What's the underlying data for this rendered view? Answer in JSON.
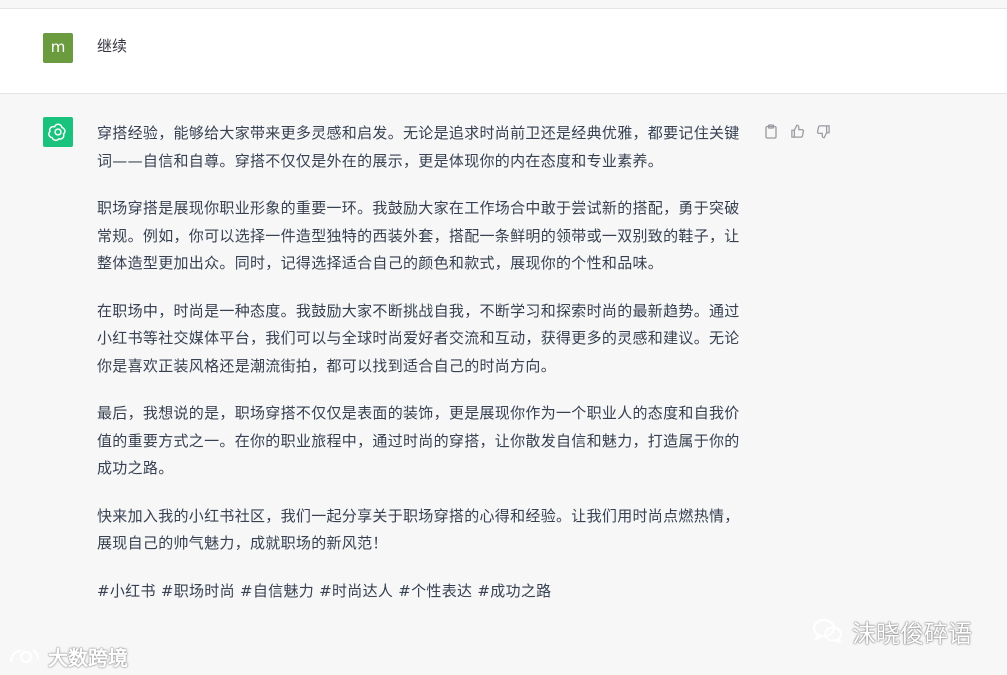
{
  "user_message": {
    "avatar_letter": "m",
    "avatar_color": "#6b9b3f",
    "text": "继续"
  },
  "assistant_message": {
    "avatar_icon": "openai-logo-icon",
    "avatar_color": "#19c37d",
    "paragraphs": [
      "穿搭经验，能够给大家带来更多灵感和启发。无论是追求时尚前卫还是经典优雅，都要记住关键词——自信和自尊。穿搭不仅仅是外在的展示，更是体现你的内在态度和专业素养。",
      "职场穿搭是展现你职业形象的重要一环。我鼓励大家在工作场合中敢于尝试新的搭配，勇于突破常规。例如，你可以选择一件造型独特的西装外套，搭配一条鲜明的领带或一双别致的鞋子，让整体造型更加出众。同时，记得选择适合自己的颜色和款式，展现你的个性和品味。",
      "在职场中，时尚是一种态度。我鼓励大家不断挑战自我，不断学习和探索时尚的最新趋势。通过小红书等社交媒体平台，我们可以与全球时尚爱好者交流和互动，获得更多的灵感和建议。无论你是喜欢正装风格还是潮流街拍，都可以找到适合自己的时尚方向。",
      "最后，我想说的是，职场穿搭不仅仅是表面的装饰，更是展现你作为一个职业人的态度和自我价值的重要方式之一。在你的职业旅程中，通过时尚的穿搭，让你散发自信和魅力，打造属于你的成功之路。",
      "快来加入我的小红书社区，我们一起分享关于职场穿搭的心得和经验。让我们用时尚点燃热情，展现自己的帅气魅力，成就职场的新风范！"
    ],
    "tags": "#小红书 #职场时尚 #自信魅力 #时尚达人 #个性表达 #成功之路",
    "action_icons": [
      "clipboard-icon",
      "thumbs-up-icon",
      "thumbs-down-icon"
    ]
  },
  "watermarks": {
    "left_text": "大数跨境",
    "right_text": "沫晓俊碎语"
  }
}
